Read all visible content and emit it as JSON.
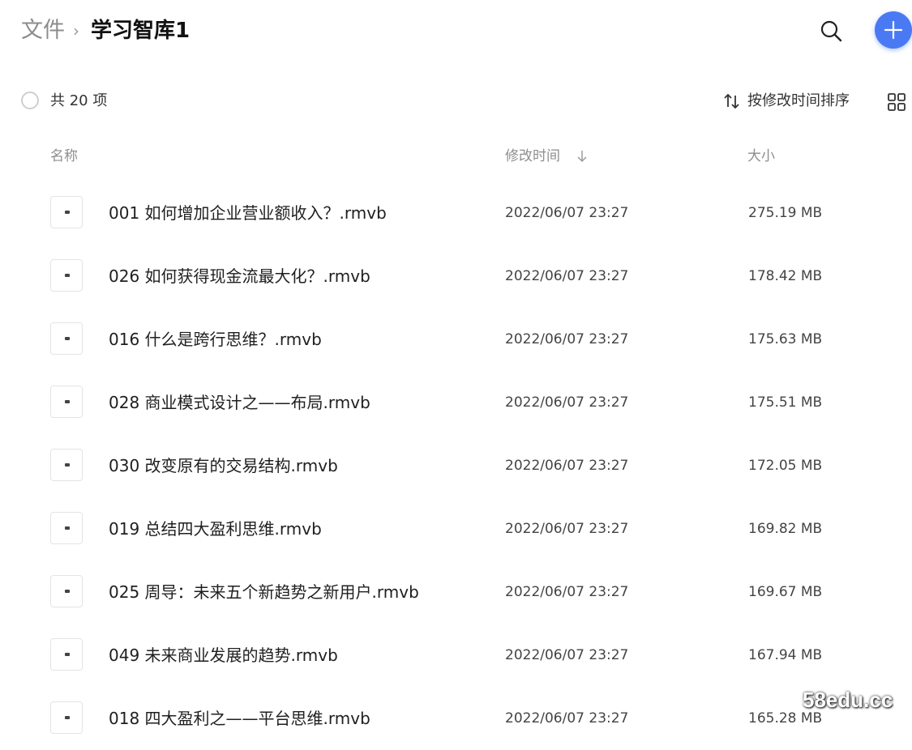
{
  "header": {
    "breadcrumb_root": "文件",
    "breadcrumb_separator": "›",
    "breadcrumb_current": "学习智库1",
    "search_icon": "search-icon",
    "add_icon": "plus-icon",
    "accent_color": "#4a7af3"
  },
  "toolbar": {
    "item_count": "共 20 项",
    "sort_label": "按修改时间排序",
    "sort_icon": "sort-arrows-icon",
    "view_icon": "grid-view-icon"
  },
  "columns": {
    "name": "名称",
    "modified": "修改时间",
    "size": "大小"
  },
  "files": [
    {
      "name": "001 如何增加企业营业额收入？.rmvb",
      "modified": "2022/06/07 23:27",
      "size": "275.19 MB"
    },
    {
      "name": "026 如何获得现金流最大化？.rmvb",
      "modified": "2022/06/07 23:27",
      "size": "178.42 MB"
    },
    {
      "name": "016 什么是跨行思维？.rmvb",
      "modified": "2022/06/07 23:27",
      "size": "175.63 MB"
    },
    {
      "name": "028 商业模式设计之——布局.rmvb",
      "modified": "2022/06/07 23:27",
      "size": "175.51 MB"
    },
    {
      "name": "030 改变原有的交易结构.rmvb",
      "modified": "2022/06/07 23:27",
      "size": "172.05 MB"
    },
    {
      "name": "019 总结四大盈利思维.rmvb",
      "modified": "2022/06/07 23:27",
      "size": "169.82 MB"
    },
    {
      "name": "025 周导：未来五个新趋势之新用户.rmvb",
      "modified": "2022/06/07 23:27",
      "size": "169.67 MB"
    },
    {
      "name": "049 未来商业发展的趋势.rmvb",
      "modified": "2022/06/07 23:27",
      "size": "167.94 MB"
    },
    {
      "name": "018 四大盈利之——平台思维.rmvb",
      "modified": "2022/06/07 23:27",
      "size": "165.28 MB"
    }
  ],
  "watermark": "58edu.cc"
}
